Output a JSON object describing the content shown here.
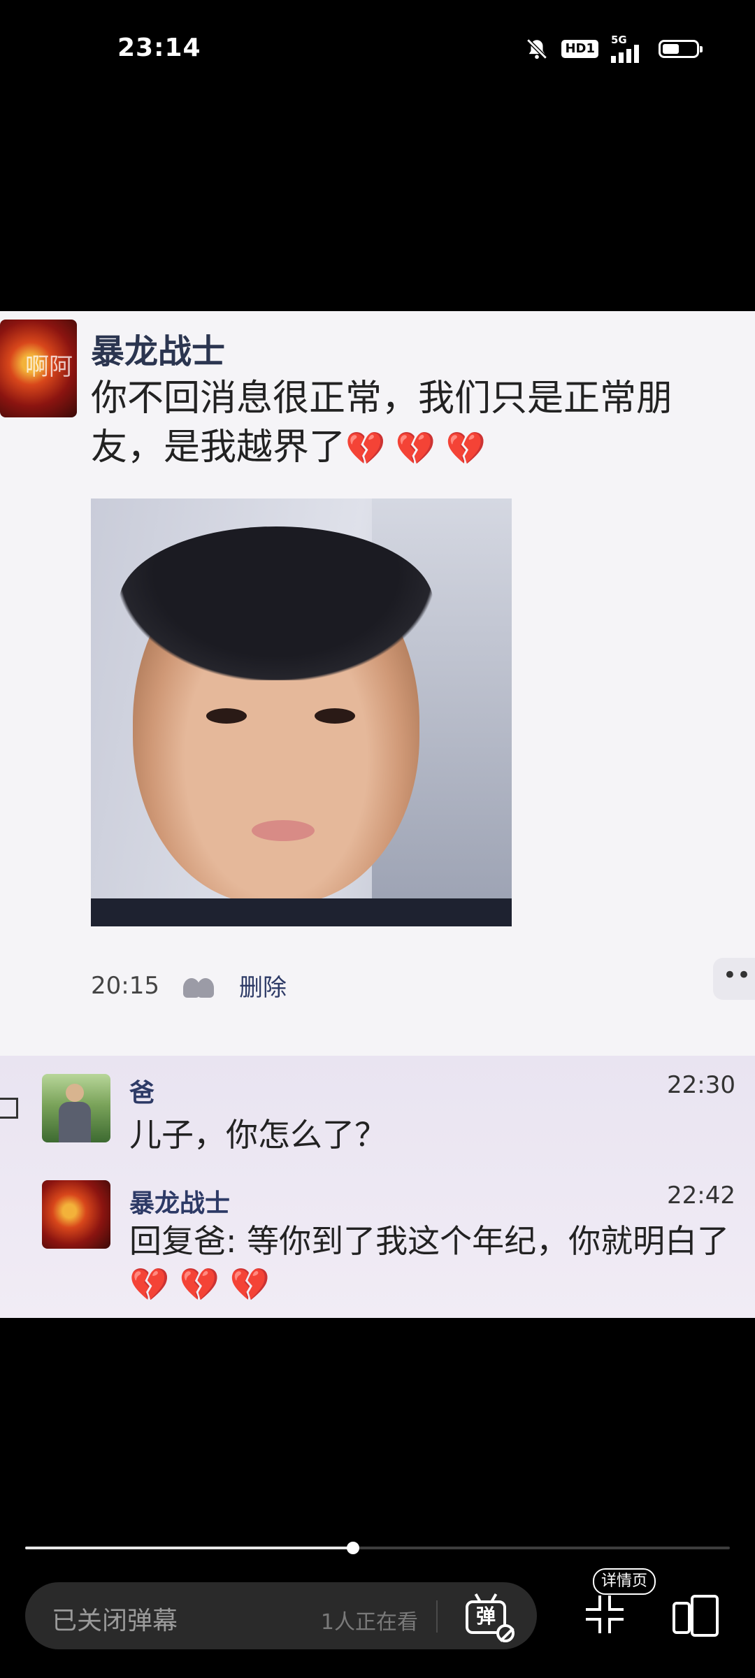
{
  "status_bar": {
    "time": "23:14",
    "hd_label": "HD1",
    "network_label": "5G",
    "battery_level": 0.55
  },
  "video": {
    "post": {
      "overlay_name": "啊阿",
      "poster_name": "暴龙战士",
      "text": "你不回消息很正常，我们只是正常朋友，是我越界了",
      "hearts": "💔 💔 💔",
      "time": "20:15",
      "delete_label": "删除",
      "more_label": "••"
    },
    "comments": [
      {
        "name": "爸",
        "time": "22:30",
        "text": "儿子，你怎么了？",
        "hearts": ""
      },
      {
        "name": "暴龙战士",
        "time": "22:42",
        "text": "回复爸: 等你到了我这个年纪，你就明白了",
        "hearts": "💔 💔 💔"
      }
    ]
  },
  "player": {
    "progress": 0.465,
    "danmaku_placeholder": "已关闭弹幕",
    "viewer_count": "1人正在看",
    "danmaku_toggle_label": "弹",
    "details_label": "详情页"
  },
  "icons": {
    "mute": "bell-off-icon",
    "signal": "signal-icon",
    "battery": "battery-icon",
    "people": "people-icon",
    "danmaku": "danmaku-off-icon",
    "shrink": "exit-fullscreen-icon",
    "details": "details-page-icon"
  },
  "colors": {
    "background": "#000000",
    "name_blue": "#2d3a66",
    "chat_bg": "#f5f4f7"
  }
}
